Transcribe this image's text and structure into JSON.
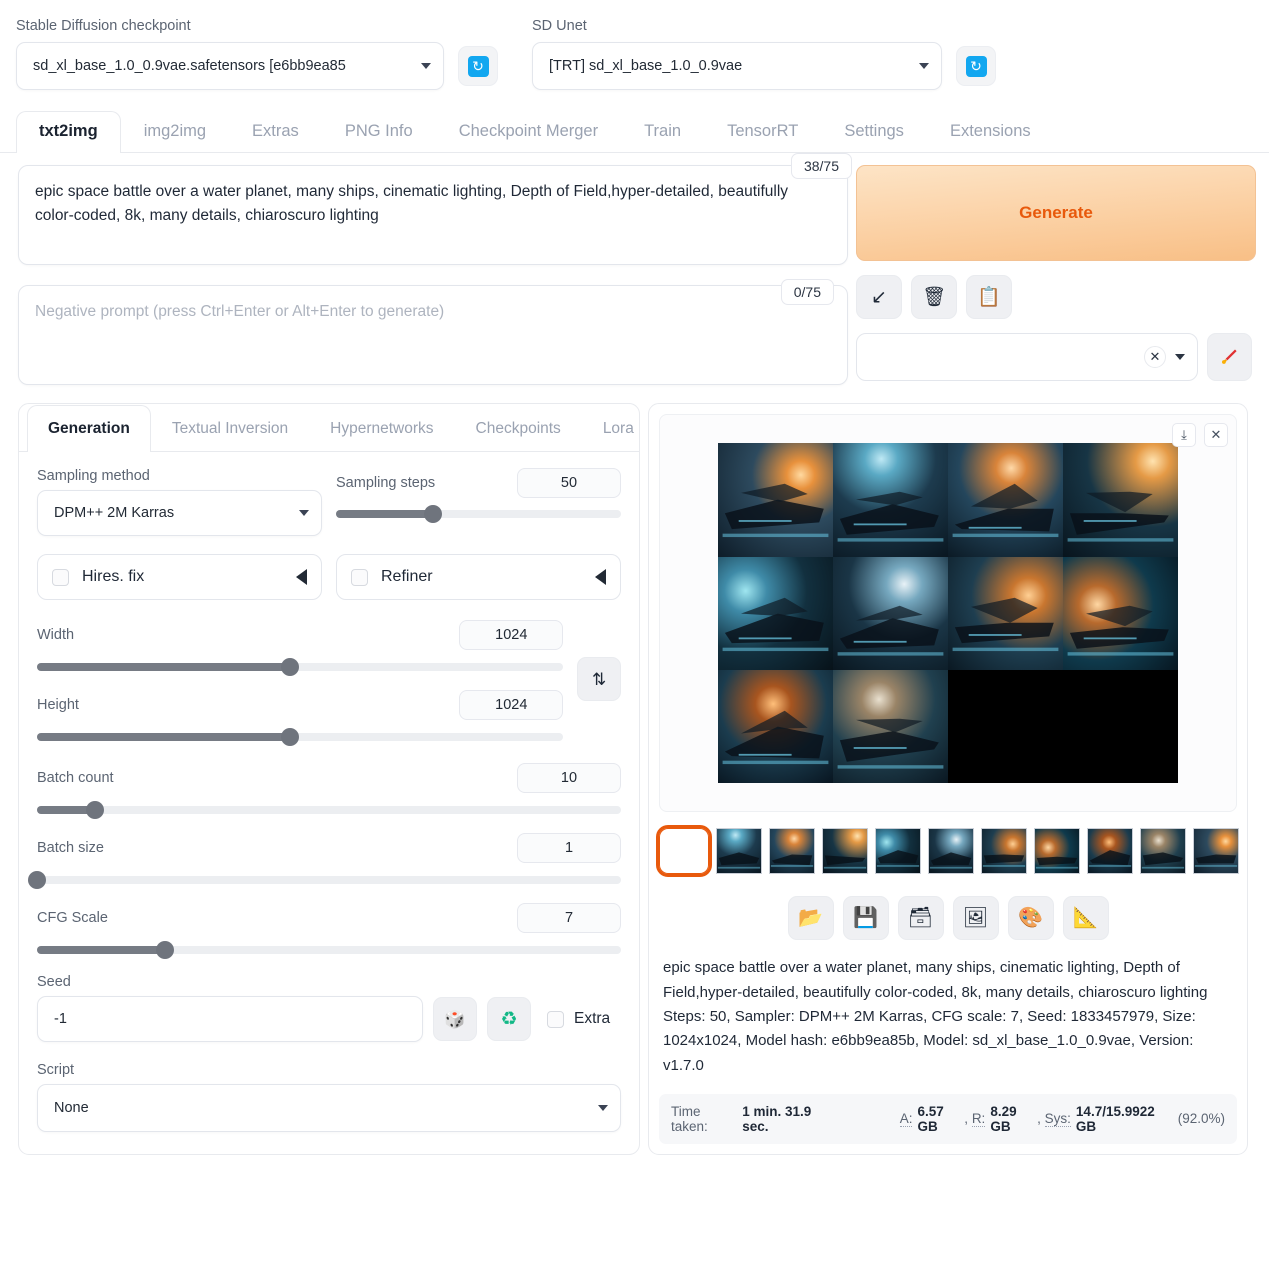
{
  "topbar": {
    "checkpoint_label": "Stable Diffusion checkpoint",
    "checkpoint_value": "sd_xl_base_1.0_0.9vae.safetensors [e6bb9ea85",
    "unet_label": "SD Unet",
    "unet_value": "[TRT] sd_xl_base_1.0_0.9vae",
    "refresh_glyph": "↻"
  },
  "main_tabs": [
    {
      "label": "txt2img",
      "active": true
    },
    {
      "label": "img2img",
      "active": false
    },
    {
      "label": "Extras",
      "active": false
    },
    {
      "label": "PNG Info",
      "active": false
    },
    {
      "label": "Checkpoint Merger",
      "active": false
    },
    {
      "label": "Train",
      "active": false
    },
    {
      "label": "TensorRT",
      "active": false
    },
    {
      "label": "Settings",
      "active": false
    },
    {
      "label": "Extensions",
      "active": false
    }
  ],
  "prompt": {
    "positive_value": "epic space battle over a water planet, many ships, cinematic lighting, Depth of Field,hyper-detailed, beautifully color-coded, 8k, many details, chiaroscuro lighting",
    "positive_tokens": "38/75",
    "negative_placeholder": "Negative prompt (press Ctrl+Enter or Alt+Enter to generate)",
    "negative_tokens": "0/75"
  },
  "generate": {
    "label": "Generate",
    "accent_color": "#e8590c",
    "tools": [
      {
        "name": "arrow-down-left-icon",
        "glyph": "↙"
      },
      {
        "name": "trash-icon",
        "glyph": "🗑"
      },
      {
        "name": "clipboard-icon",
        "glyph": "📋"
      }
    ],
    "styles_value": "",
    "clear_glyph": "✕",
    "brush_glyph": "🖌"
  },
  "sub_tabs": [
    {
      "label": "Generation",
      "active": true
    },
    {
      "label": "Textual Inversion",
      "active": false
    },
    {
      "label": "Hypernetworks",
      "active": false
    },
    {
      "label": "Checkpoints",
      "active": false
    },
    {
      "label": "Lora",
      "active": false
    }
  ],
  "settings": {
    "sampling_method_label": "Sampling method",
    "sampling_method_value": "DPM++ 2M Karras",
    "sampling_steps_label": "Sampling steps",
    "sampling_steps_value": "50",
    "sampling_steps_pct": 34,
    "hires_fix_label": "Hires. fix",
    "refiner_label": "Refiner",
    "width_label": "Width",
    "width_value": "1024",
    "width_pct": 48,
    "height_label": "Height",
    "height_value": "1024",
    "height_pct": 48,
    "swap_glyph": "⇅",
    "batch_count_label": "Batch count",
    "batch_count_value": "10",
    "batch_count_pct": 10,
    "batch_size_label": "Batch size",
    "batch_size_value": "1",
    "batch_size_pct": 0,
    "cfg_label": "CFG Scale",
    "cfg_value": "7",
    "cfg_pct": 22,
    "seed_label": "Seed",
    "seed_value": "-1",
    "dice_glyph": "🎲",
    "recycle_glyph": "♻",
    "extra_label": "Extra",
    "script_label": "Script",
    "script_value": "None"
  },
  "result": {
    "download_glyph": "⤓",
    "close_glyph": "✕",
    "actions": [
      {
        "name": "open-folder-icon",
        "glyph": "📂"
      },
      {
        "name": "save-icon",
        "glyph": "💾"
      },
      {
        "name": "save-zip-icon",
        "glyph": "🗃"
      },
      {
        "name": "send-to-img2img-icon",
        "glyph": "🖼"
      },
      {
        "name": "send-to-inpaint-icon",
        "glyph": "🎨"
      },
      {
        "name": "send-to-extras-icon",
        "glyph": "📐"
      }
    ],
    "info_prompt": "epic space battle over a water planet, many ships, cinematic lighting, Depth of Field,hyper-detailed, beautifully color-coded, 8k, many details, chiaroscuro lighting",
    "info_params": "Steps: 50, Sampler: DPM++ 2M Karras, CFG scale: 7, Seed: 1833457979, Size: 1024x1024, Model hash: e6bb9ea85b, Model: sd_xl_base_1.0_0.9vae, Version: v1.7.0",
    "time_label": "Time taken:",
    "time_value": "1 min. 31.9 sec.",
    "mem_a_label": "A:",
    "mem_a_value": "6.57 GB",
    "mem_r_label": "R:",
    "mem_r_value": "8.29 GB",
    "mem_sys_label": "Sys:",
    "mem_sys_value": "14.7/15.9922 GB",
    "mem_sys_pct": "(92.0%)",
    "thumb_count": 11,
    "selected_thumb": 0
  }
}
